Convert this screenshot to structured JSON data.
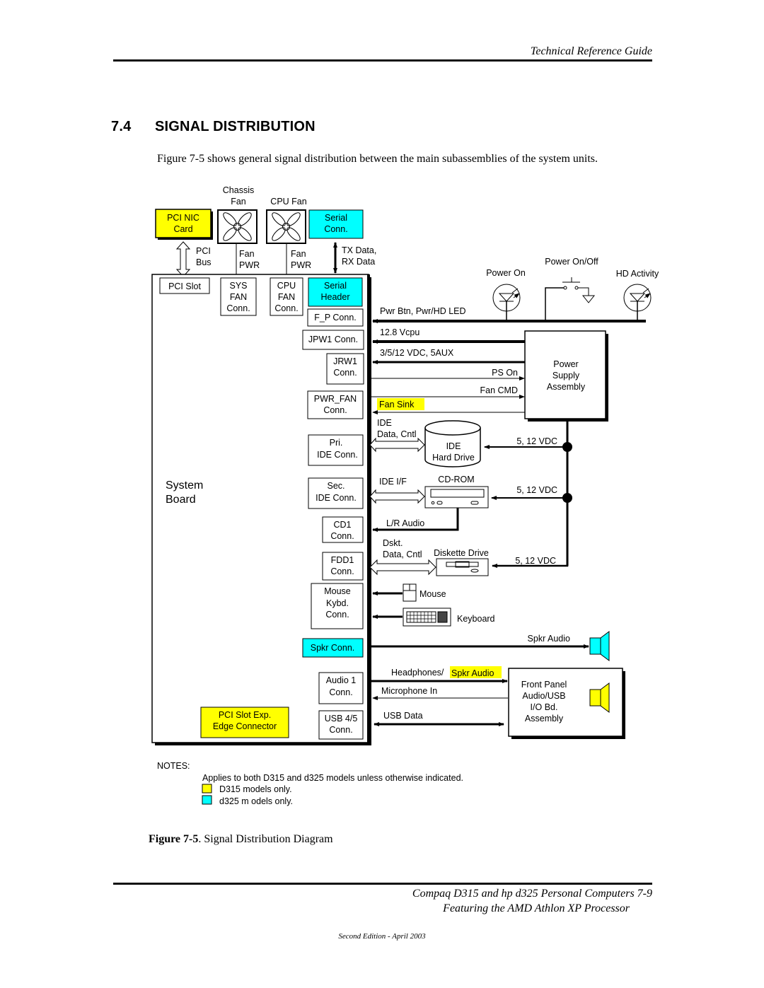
{
  "header": {
    "title": "Technical Reference Guide"
  },
  "section": {
    "number": "7.4",
    "title": "SIGNAL DISTRIBUTION"
  },
  "intro": "Figure 7-5 shows general signal distribution between the main subassemblies of the system units.",
  "colors": {
    "d315_only": "#ffff00",
    "d325_only": "#00ffff",
    "line": "#000000"
  },
  "diagram": {
    "top_labels": {
      "chassis_fan": [
        "Chassis",
        "Fan"
      ],
      "cpu_fan": "CPU Fan",
      "pci_nic": [
        "PCI NIC",
        "Card"
      ],
      "serial_conn": [
        "Serial",
        "Conn."
      ],
      "pci_bus": [
        "PCI",
        "Bus"
      ],
      "fan_pwr_1": [
        "Fan",
        "PWR"
      ],
      "fan_pwr_2": [
        "Fan",
        "PWR"
      ],
      "tx_rx": [
        "TX Data,",
        "RX Data"
      ]
    },
    "system_board": {
      "label": [
        "System",
        "Board"
      ],
      "pci_slot": "PCI Slot",
      "sys_fan": [
        "SYS",
        "FAN",
        "Conn."
      ],
      "cpu_fan": [
        "CPU",
        "FAN",
        "Conn."
      ],
      "serial_header": [
        "Serial",
        "Header"
      ],
      "connectors": {
        "fp": "F_P Conn.",
        "jpw1": "JPW1 Conn.",
        "jrw1": [
          "JRW1",
          "Conn."
        ],
        "pwr_fan": [
          "PWR_FAN",
          "Conn."
        ],
        "pri_ide": [
          "Pri.",
          "IDE Conn."
        ],
        "sec_ide": [
          "Sec.",
          "IDE Conn."
        ],
        "cd1": [
          "CD1",
          "Conn."
        ],
        "fdd1": [
          "FDD1",
          "Conn."
        ],
        "mouse_kybd": [
          "Mouse",
          "Kybd.",
          "Conn."
        ],
        "spkr": "Spkr Conn.",
        "audio1": [
          "Audio 1",
          "Conn."
        ],
        "usb45": [
          "USB 4/5",
          "Conn."
        ]
      },
      "pci_slot_exp": [
        "PCI Slot Exp.",
        "Edge Connector"
      ]
    },
    "front_panel": {
      "power_on": "Power On",
      "power_on_off": "Power On/Off",
      "hd_activity": "HD Activity"
    },
    "signals": {
      "pwr_btn": "Pwr Btn, Pwr/HD LED",
      "vcpu": "12.8 Vcpu",
      "vdc_aux": "3/5/12 VDC, 5AUX",
      "ps_on": "PS On",
      "fan_cmd": "Fan CMD",
      "fan_sink": "Fan Sink",
      "ide_data": [
        "IDE",
        "Data, Cntl"
      ],
      "ide_if": "IDE I/F",
      "lr_audio": "L/R Audio",
      "dskt": [
        "Dskt.",
        "Data, Cntl"
      ],
      "vdc_hd": "5, 12 VDC",
      "vdc_cd": "5, 12 VDC",
      "vdc_fd": "5, 12 VDC",
      "mouse": "Mouse",
      "keyboard": "Keyboard",
      "spkr_audio": "Spkr Audio",
      "headphones": "Headphones/",
      "headphones_spkr": "Spkr Audio",
      "mic_in": "Microphone In",
      "usb_data": "USB Data"
    },
    "devices": {
      "power_supply": [
        "Power",
        "Supply",
        "Assembly"
      ],
      "hard_drive": [
        "IDE",
        "Hard Drive"
      ],
      "cdrom": "CD-ROM",
      "diskette": "Diskette Drive",
      "front_panel_io": [
        "Front Panel",
        "Audio/USB",
        "I/O Bd.",
        "Assembly"
      ]
    },
    "notes": {
      "heading": "NOTES:",
      "general": "Applies to both D315 and d325 models unless otherwise indicated.",
      "d315": "D315 models only.",
      "d325": "d325 m odels only."
    }
  },
  "caption": {
    "label": "Figure 7-5",
    "text": ". Signal Distribution Diagram"
  },
  "footer": {
    "line1": "Compaq D315 and hp d325 Personal Computers  7-9",
    "line2": "Featuring the AMD Athlon XP Processor",
    "edition": "Second Edition - April 2003"
  }
}
